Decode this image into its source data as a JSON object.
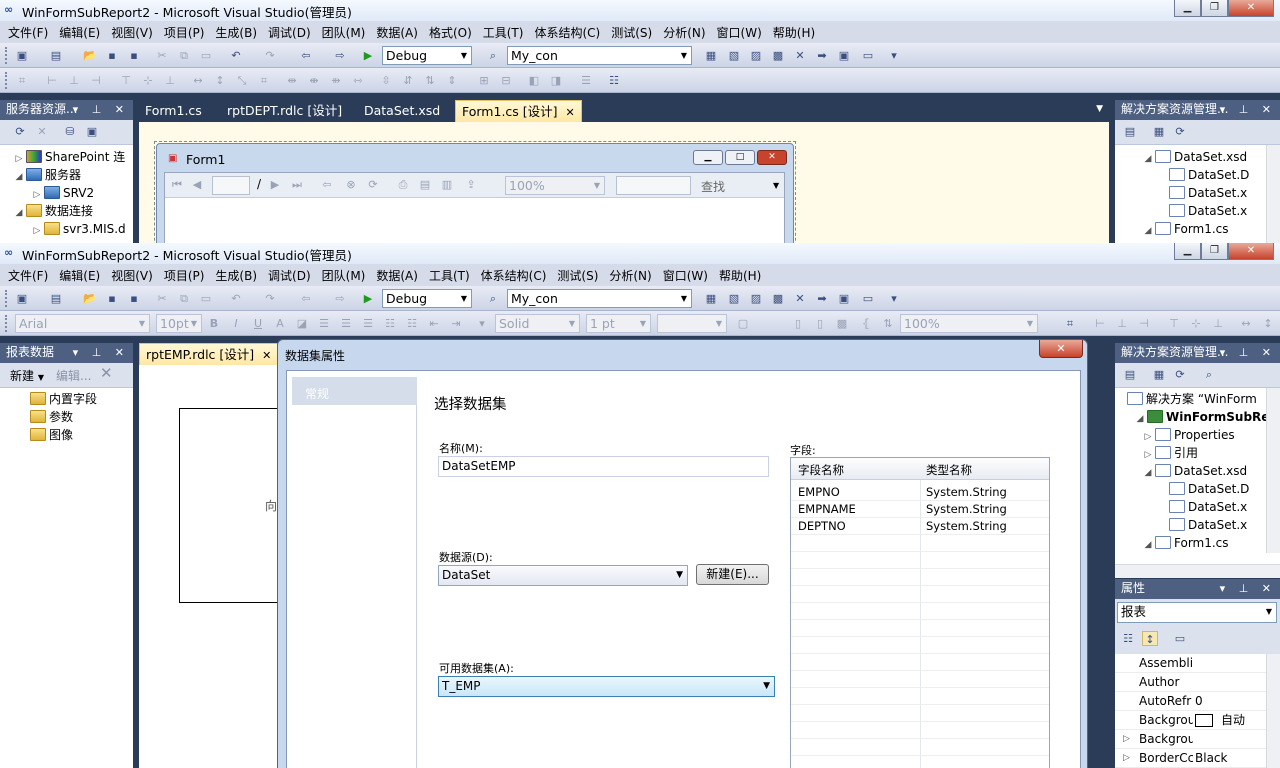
{
  "top_window": {
    "title": "WinFormSubReport2 - Microsoft Visual Studio(管理员)",
    "menu": [
      "文件(F)",
      "编辑(E)",
      "视图(V)",
      "项目(P)",
      "生成(B)",
      "调试(D)",
      "团队(M)",
      "数据(A)",
      "格式(O)",
      "工具(T)",
      "体系结构(C)",
      "测试(S)",
      "分析(N)",
      "窗口(W)",
      "帮助(H)"
    ],
    "config_combo": "Debug",
    "connection_combo": "My_con",
    "left_panel": {
      "title": "服务器资源...",
      "tree": [
        {
          "label": "SharePoint 连",
          "expander": "▷",
          "icon": "sharepoint-icon"
        },
        {
          "label": "服务器",
          "expander": "◢",
          "icon": "server-icon"
        },
        {
          "label": "SRV2",
          "expander": "▷",
          "icon": "computer-icon"
        },
        {
          "label": "数据连接",
          "expander": "◢",
          "icon": "data-connection-icon"
        },
        {
          "label": "svr3.MIS.d",
          "expander": "▷",
          "icon": "database-icon"
        }
      ]
    },
    "tabs": [
      {
        "label": "Form1.cs"
      },
      {
        "label": "rptDEPT.rdlc [设计]"
      },
      {
        "label": "DataSet.xsd"
      },
      {
        "label": "Form1.cs [设计]"
      }
    ],
    "form_designer": {
      "form_title": "Form1",
      "viewer_zoom": "100%",
      "viewer_page_sep": "/",
      "viewer_find": "查找"
    },
    "right_panel": {
      "title": "解决方案资源管理...",
      "tree": [
        {
          "label": "DataSet.xsd",
          "expander": "◢"
        },
        {
          "label": "DataSet.D",
          "expander": ""
        },
        {
          "label": "DataSet.x",
          "expander": ""
        },
        {
          "label": "DataSet.x",
          "expander": ""
        },
        {
          "label": "Form1.cs",
          "expander": "◢"
        }
      ]
    }
  },
  "bottom_window": {
    "title": "WinFormSubReport2 - Microsoft Visual Studio(管理员)",
    "menu": [
      "文件(F)",
      "编辑(E)",
      "视图(V)",
      "项目(P)",
      "生成(B)",
      "调试(D)",
      "团队(M)",
      "数据(A)",
      "工具(T)",
      "体系结构(C)",
      "测试(S)",
      "分析(N)",
      "窗口(W)",
      "帮助(H)"
    ],
    "config_combo": "Debug",
    "connection_combo": "My_con",
    "format_toolbar": {
      "font": "Arial",
      "size": "10pt",
      "line_style": "Solid",
      "line_width": "1 pt",
      "zoom": "100%"
    },
    "left_panel": {
      "title": "报表数据",
      "new_label": "新建",
      "edit_label": "编辑...",
      "tree": [
        {
          "label": "内置字段"
        },
        {
          "label": "参数"
        },
        {
          "label": "图像"
        }
      ]
    },
    "doc_tab": "rptEMP.rdlc [设计]",
    "report_body_fragment": "向",
    "right_panel": {
      "title": "解决方案资源管理...",
      "tree": [
        {
          "label": "解决方案 “WinForm",
          "expander": ""
        },
        {
          "label": "WinFormSubRe",
          "expander": "◢"
        },
        {
          "label": "Properties",
          "expander": "▷"
        },
        {
          "label": "引用",
          "expander": "▷"
        },
        {
          "label": "DataSet.xsd",
          "expander": "◢"
        },
        {
          "label": "DataSet.D",
          "expander": ""
        },
        {
          "label": "DataSet.x",
          "expander": ""
        },
        {
          "label": "DataSet.x",
          "expander": ""
        },
        {
          "label": "Form1.cs",
          "expander": "◢"
        }
      ]
    },
    "properties_panel": {
      "title": "属性",
      "object": "报表",
      "rows": [
        {
          "name": "Assembli",
          "value": ""
        },
        {
          "name": "Author",
          "value": ""
        },
        {
          "name": "AutoRefr",
          "value": "0"
        },
        {
          "name": "Backgrou",
          "value": "自动"
        },
        {
          "name": "Backgrou",
          "value": ""
        },
        {
          "name": "BorderCc",
          "value": "Black"
        }
      ]
    }
  },
  "dialog": {
    "title": "数据集属性",
    "nav_item": "常规",
    "heading": "选择数据集",
    "name_label": "名称(M):",
    "name_value": "DataSetEMP",
    "source_label": "数据源(D):",
    "source_value": "DataSet",
    "new_button": "新建(E)...",
    "available_label": "可用数据集(A):",
    "available_value": "T_EMP",
    "fields_label": "字段:",
    "columns": [
      "字段名称",
      "类型名称"
    ],
    "fields": [
      {
        "name": "EMPNO",
        "type": "System.String"
      },
      {
        "name": "EMPNAME",
        "type": "System.String"
      },
      {
        "name": "DEPTNO",
        "type": "System.String"
      }
    ]
  },
  "colors": {
    "ide_background": "#2b3c59",
    "panel_header": "#4d6082",
    "active_tab": "#ffe8a6",
    "close_button": "#c7432b"
  }
}
